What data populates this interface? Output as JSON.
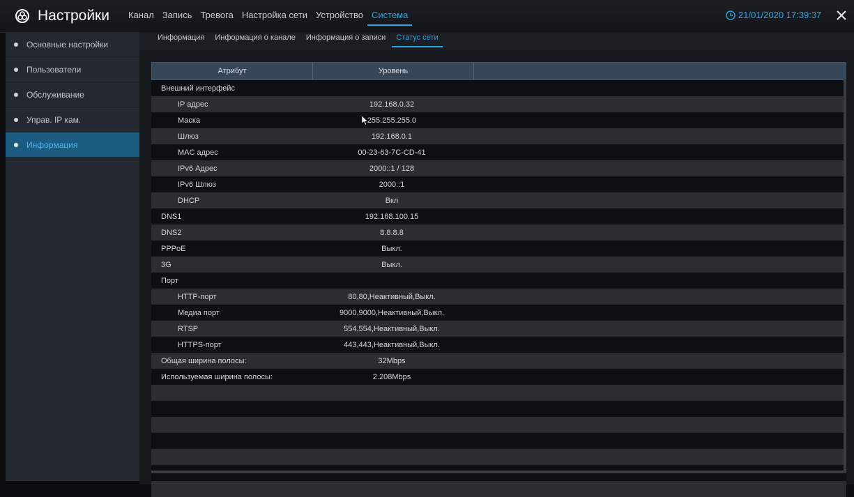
{
  "header": {
    "title": "Настройки",
    "menu": [
      "Канал",
      "Запись",
      "Тревога",
      "Настройка сети",
      "Устройство",
      "Система"
    ],
    "active_menu": "Система",
    "datetime": "21/01/2020 17:39:37"
  },
  "sidebar": {
    "items": [
      {
        "label": "Основные настройки"
      },
      {
        "label": "Пользователи"
      },
      {
        "label": "Обслуживание"
      },
      {
        "label": "Управ. IP кам."
      },
      {
        "label": "Информация"
      }
    ],
    "active": "Информация"
  },
  "subtabs": {
    "items": [
      "Информация",
      "Информация о канале",
      "Информация о записи",
      "Статус сети"
    ],
    "active": "Статус сети"
  },
  "table": {
    "headers": [
      "Атрибут",
      "Уровень"
    ],
    "rows": [
      {
        "attr": "Внешний интерфейс",
        "value": "",
        "indent": false
      },
      {
        "attr": "IP адрес",
        "value": "192.168.0.32",
        "indent": true
      },
      {
        "attr": "Маска",
        "value": "255.255.255.0",
        "indent": true
      },
      {
        "attr": "Шлюз",
        "value": "192.168.0.1",
        "indent": true
      },
      {
        "attr": "MAC адрес",
        "value": "00-23-63-7C-CD-41",
        "indent": true
      },
      {
        "attr": "IPv6 Адрес",
        "value": "2000::1 / 128",
        "indent": true
      },
      {
        "attr": "IPv6 Шлюз",
        "value": "2000::1",
        "indent": true
      },
      {
        "attr": "DHCP",
        "value": "Вкл",
        "indent": true
      },
      {
        "attr": "DNS1",
        "value": "192.168.100.15",
        "indent": false
      },
      {
        "attr": "DNS2",
        "value": "8.8.8.8",
        "indent": false
      },
      {
        "attr": "PPPoE",
        "value": "Выкл.",
        "indent": false
      },
      {
        "attr": "3G",
        "value": "Выкл.",
        "indent": false
      },
      {
        "attr": "Порт",
        "value": "",
        "indent": false
      },
      {
        "attr": "HTTP-порт",
        "value": "80,80,Неактивный,Выкл.",
        "indent": true
      },
      {
        "attr": "Медиа порт",
        "value": "9000,9000,Неактивный,Выкл.",
        "indent": true
      },
      {
        "attr": "RTSP",
        "value": "554,554,Неактивный,Выкл.",
        "indent": true
      },
      {
        "attr": "HTTPS-порт",
        "value": "443,443,Неактивный,Выкл.",
        "indent": true
      },
      {
        "attr": "Общая ширина полосы:",
        "value": "32Mbps",
        "indent": false
      },
      {
        "attr": "Используемая ширина полосы:",
        "value": "2.208Mbps",
        "indent": false
      },
      {
        "attr": "",
        "value": "",
        "indent": false
      },
      {
        "attr": "",
        "value": "",
        "indent": false
      },
      {
        "attr": "",
        "value": "",
        "indent": false
      },
      {
        "attr": "",
        "value": "",
        "indent": false
      },
      {
        "attr": "",
        "value": "",
        "indent": false
      },
      {
        "attr": "",
        "value": "",
        "indent": false
      },
      {
        "attr": "",
        "value": "",
        "indent": false
      }
    ]
  },
  "colors": {
    "accent": "#29a7e1",
    "sidebar_active": "#1c5b82"
  }
}
